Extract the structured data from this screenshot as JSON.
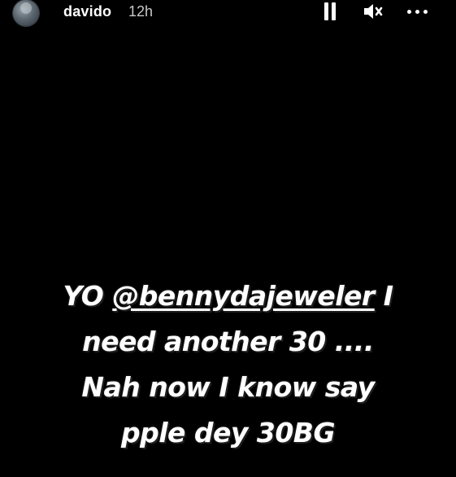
{
  "header": {
    "username": "davido",
    "time": "12h",
    "icons": {
      "avatar": "profile-avatar",
      "pause": "pause-icon",
      "mute": "speaker-muted-icon",
      "more": "more-dots-icon"
    }
  },
  "caption": {
    "line1_prefix": "YO",
    "mention": "@bennydajeweler",
    "line1_suffix": "I",
    "line2": "need another 30 ....",
    "line3": "Nah now I know say",
    "line4": "pple dey 30BG"
  },
  "colors": {
    "background": "#000000",
    "text": "#ffffff",
    "time_text": "#c8c8c8"
  }
}
